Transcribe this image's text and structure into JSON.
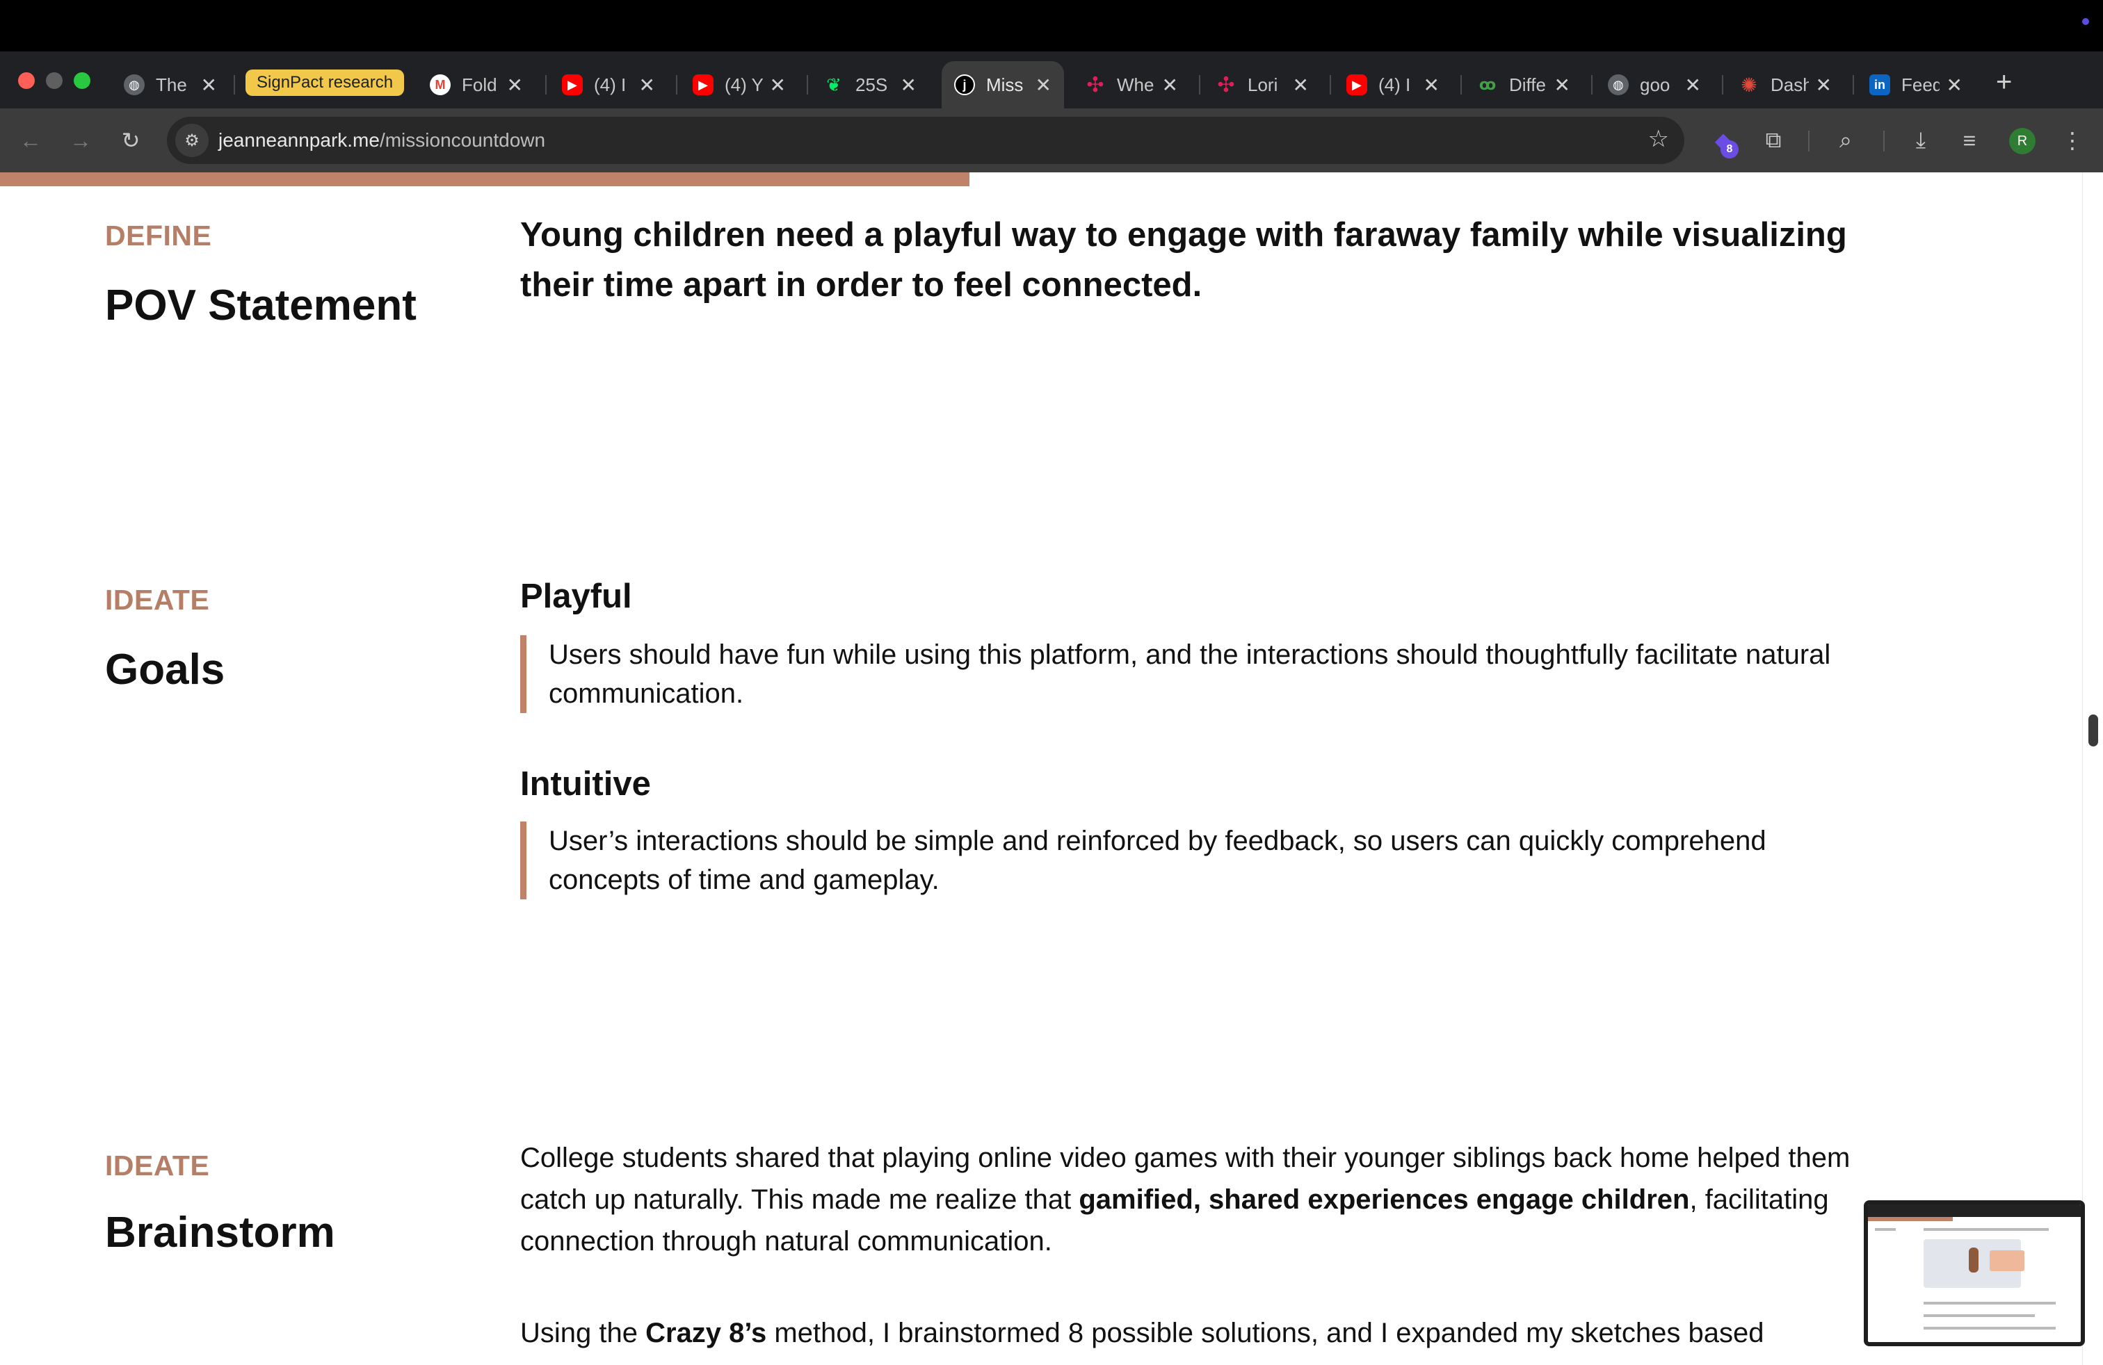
{
  "browser": {
    "tabs": [
      {
        "title": "The",
        "icon": "globe-icon",
        "icon_color": "#5f6368"
      },
      {
        "title": "Fold",
        "icon": "gmail-icon",
        "icon_color": "#ea4335"
      },
      {
        "title": "(4) I",
        "icon": "youtube-icon",
        "icon_color": "#ff0000"
      },
      {
        "title": "(4) Y",
        "icon": "youtube-icon",
        "icon_color": "#ff0000"
      },
      {
        "title": "25S",
        "icon": "mongodb-leaf-icon",
        "icon_color": "#00ed64"
      },
      {
        "title": "Miss",
        "icon": "site-j-icon",
        "icon_color": "#000000"
      },
      {
        "title": "Whe",
        "icon": "slack-icon",
        "icon_color": "#e01e5a"
      },
      {
        "title": "Lori",
        "icon": "slack-icon",
        "icon_color": "#e01e5a"
      },
      {
        "title": "(4) I",
        "icon": "youtube-icon",
        "icon_color": "#ff0000"
      },
      {
        "title": "Diffe",
        "icon": "diff-icon",
        "icon_color": "#2e7d32"
      },
      {
        "title": "goo",
        "icon": "globe-icon",
        "icon_color": "#5f6368"
      },
      {
        "title": "Dash",
        "icon": "canvas-icon",
        "icon_color": "#e4493b"
      },
      {
        "title": "Feed",
        "icon": "linkedin-icon",
        "icon_color": "#0a66c2"
      }
    ],
    "tab_group": {
      "label": "SignPact research",
      "color": "#f2c84b"
    },
    "url_host": "jeanneannpark.me",
    "url_path": "/missioncountdown",
    "extensions_badge": "8",
    "profile_initial": "R"
  },
  "page": {
    "reading_progress": 0.47,
    "accent_color": "#c1826a",
    "define": {
      "label": "DEFINE",
      "title": "POV Statement",
      "statement": "Young children need a playful way to engage with faraway family while visualizing their time apart in order to feel connected."
    },
    "goals": {
      "label": "IDEATE",
      "title": "Goals",
      "items": [
        {
          "heading": "Playful",
          "text": "Users should have fun while using this platform, and the interactions should thoughtfully facilitate natural communication."
        },
        {
          "heading": "Intuitive",
          "text": "User’s interactions should be simple and reinforced by feedback, so users can quickly comprehend concepts of time and gameplay."
        }
      ]
    },
    "brainstorm": {
      "label": "IDEATE",
      "title": "Brainstorm",
      "p1_a": "College students shared that playing online video games with their younger siblings back home helped them catch up naturally. This made me realize that ",
      "p1_bold": "gamified, shared experiences engage children",
      "p1_b": ", facilitating connection through natural communication.",
      "p2_a": "Using the ",
      "p2_bold": "Crazy 8’s",
      "p2_b": " method, I brainstormed 8 possible solutions, and I expanded my sketches based"
    }
  }
}
